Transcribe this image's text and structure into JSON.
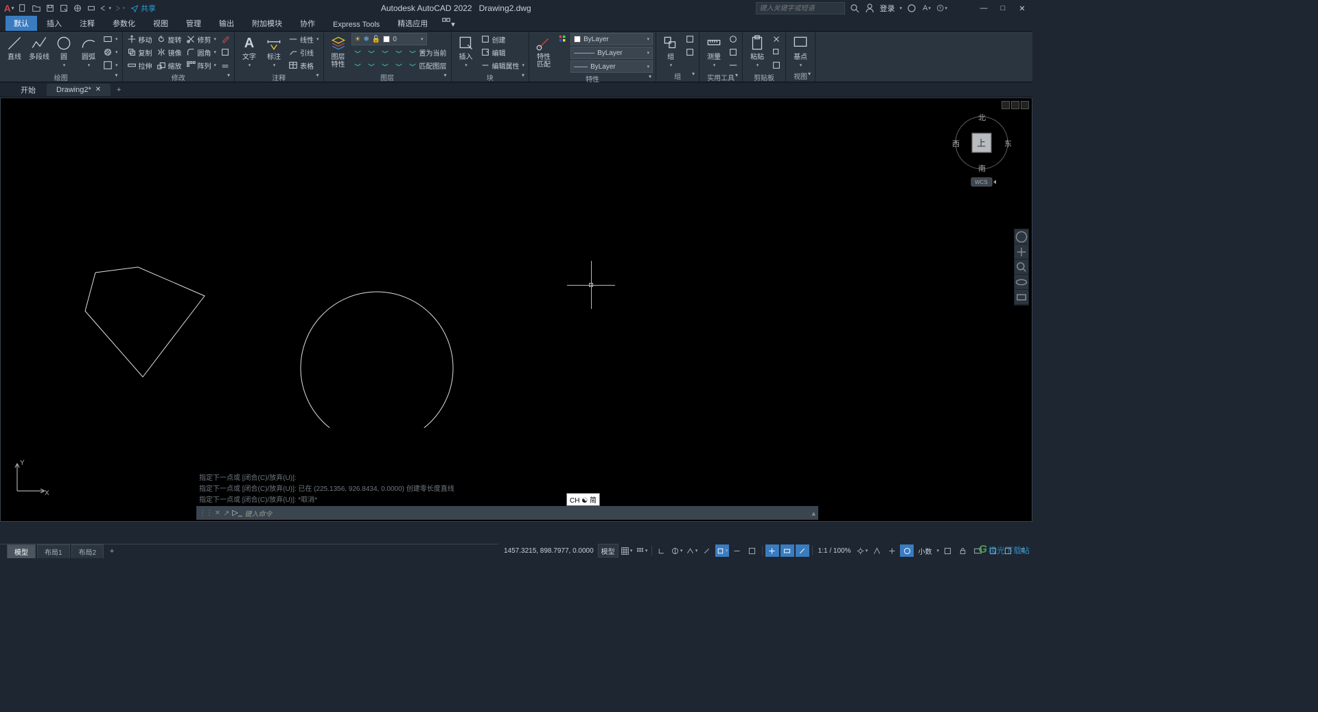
{
  "title": {
    "app": "Autodesk AutoCAD 2022",
    "file": "Drawing2.dwg"
  },
  "qat": {
    "share": "共享"
  },
  "search": {
    "placeholder": "键入关键字或短语"
  },
  "login": {
    "text": "登录"
  },
  "menu": {
    "tabs": [
      "默认",
      "插入",
      "注释",
      "参数化",
      "视图",
      "管理",
      "输出",
      "附加模块",
      "协作",
      "Express Tools",
      "精选应用"
    ]
  },
  "ribbon": {
    "draw": {
      "title": "绘图",
      "line": "直线",
      "pline": "多段线",
      "circle": "圆",
      "arc": "圆弧"
    },
    "modify": {
      "title": "修改",
      "move": "移动",
      "rotate": "旋转",
      "trim": "修剪",
      "copy": "复制",
      "mirror": "镜像",
      "fillet": "圆角",
      "stretch": "拉伸",
      "scale": "缩放",
      "array": "阵列"
    },
    "annotation": {
      "title": "注释",
      "text": "文字",
      "dim": "标注",
      "linear": "线性",
      "leader": "引线",
      "table": "表格"
    },
    "layers": {
      "title": "图层",
      "props": "图层\n特性",
      "combo": "0",
      "setcurrent": "置为当前",
      "match": "匹配图层"
    },
    "block": {
      "title": "块",
      "insert": "插入",
      "create": "创建",
      "edit": "编辑",
      "editattr": "编辑属性"
    },
    "properties": {
      "title": "特性",
      "match": "特性\n匹配",
      "bylayer": "ByLayer"
    },
    "group": {
      "title": "组",
      "group": "组"
    },
    "utilities": {
      "title": "实用工具",
      "measure": "测量"
    },
    "clipboard": {
      "title": "剪贴板",
      "paste": "粘贴"
    },
    "view": {
      "title": "视图",
      "base": "基点"
    }
  },
  "filetabs": {
    "start": "开始",
    "drawing": "Drawing2*"
  },
  "viewcube": {
    "n": "北",
    "s": "南",
    "e": "东",
    "w": "西",
    "top": "上",
    "wcs": "WCS"
  },
  "cmd": {
    "h1": "指定下一点或 [闭合(C)/放弃(U)]:",
    "h2": "指定下一点或 [闭合(C)/放弃(U)]: 已在 (225.1356, 926.8434, 0.0000) 创建零长度直线",
    "h3": "指定下一点或 [闭合(C)/放弃(U)]: *取消*",
    "prompt": "键入命令"
  },
  "ime": {
    "text": "CH ☯ 简"
  },
  "layouts": {
    "model": "模型",
    "l1": "布局1",
    "l2": "布局2"
  },
  "status": {
    "coords": "1457.3215, 898.7977, 0.0000",
    "model": "模型",
    "scale": "1:1 / 100%",
    "decimal": "小数"
  },
  "watermark": {
    "text": "极光下载站"
  }
}
